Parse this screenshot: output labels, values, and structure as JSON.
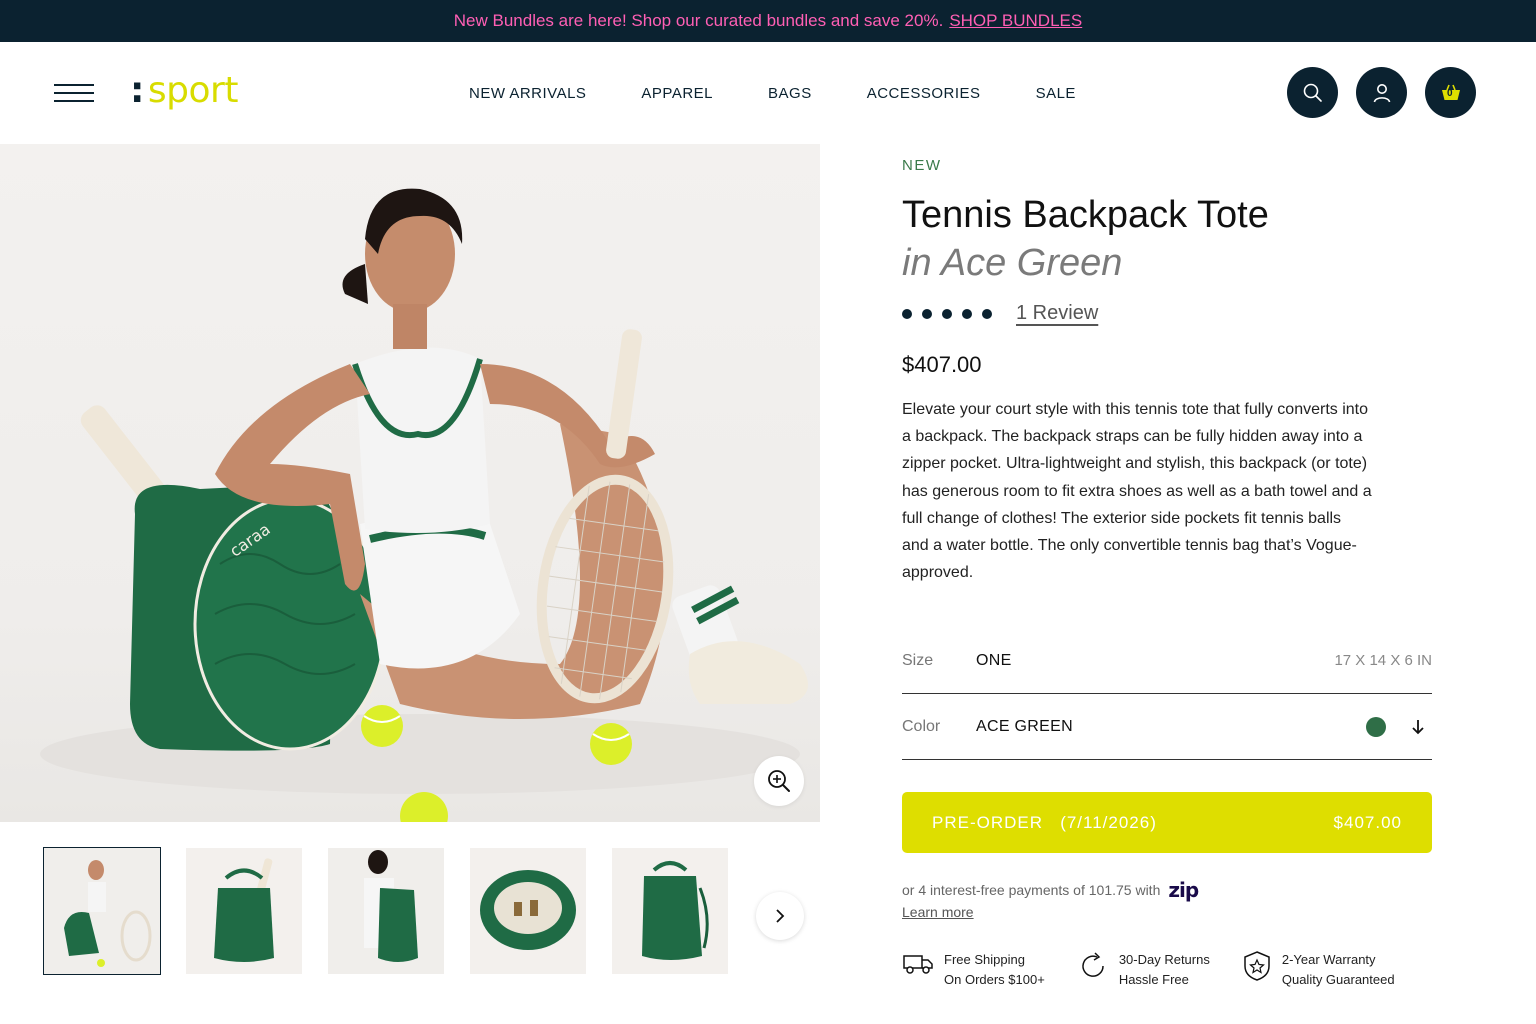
{
  "announcement": {
    "text": "New Bundles are here! Shop our curated bundles and save 20%.",
    "link": "SHOP BUNDLES"
  },
  "header": {
    "logo": "sport",
    "nav": [
      "NEW ARRIVALS",
      "APPAREL",
      "BAGS",
      "ACCESSORIES",
      "SALE"
    ],
    "cart_count": "0",
    "icons": [
      "search-icon",
      "user-icon",
      "basket-icon"
    ]
  },
  "product": {
    "badge": "NEW",
    "title": "Tennis Backpack Tote",
    "subtitle": "in Ace Green",
    "rating_dots": 5,
    "reviews": "1 Review",
    "price": "$407.00",
    "description": "Elevate your court style with this tennis tote that fully converts into a backpack. The backpack straps can be fully hidden away into a zipper pocket. Ultra-lightweight and stylish, this backpack (or tote) has generous room to fit extra shoes as well as a bath towel and a full change of clothes! The exterior side pockets fit tennis balls and a water bottle. The only convertible tennis bag that’s Vogue-approved.",
    "size": {
      "label": "Size",
      "value": "ONE",
      "dims": "17 X 14 X 6 IN"
    },
    "color": {
      "label": "Color",
      "value": "ACE GREEN",
      "swatch": "#2f6e47"
    },
    "preorder": {
      "label": "PRE-ORDER",
      "date": "(7/11/2026)",
      "price": "$407.00"
    },
    "payments": {
      "text": "or 4 interest-free payments of 101.75 with",
      "provider": "zip",
      "learn_more": "Learn more"
    },
    "perks": [
      {
        "icon": "truck-icon",
        "line1": "Free Shipping",
        "line2": "On Orders $100+"
      },
      {
        "icon": "return-icon",
        "line1": "30-Day Returns",
        "line2": "Hassle Free"
      },
      {
        "icon": "shield-star-icon",
        "line1": "2-Year Warranty",
        "line2": "Quality Guaranteed"
      }
    ]
  },
  "gallery": {
    "thumbnail_count": 5,
    "active_index": 0
  },
  "colors": {
    "dark": "#0b2230",
    "accent_pink": "#ff5fb4",
    "accent_yellow": "#dede00",
    "bag_green": "#1f6b45"
  }
}
